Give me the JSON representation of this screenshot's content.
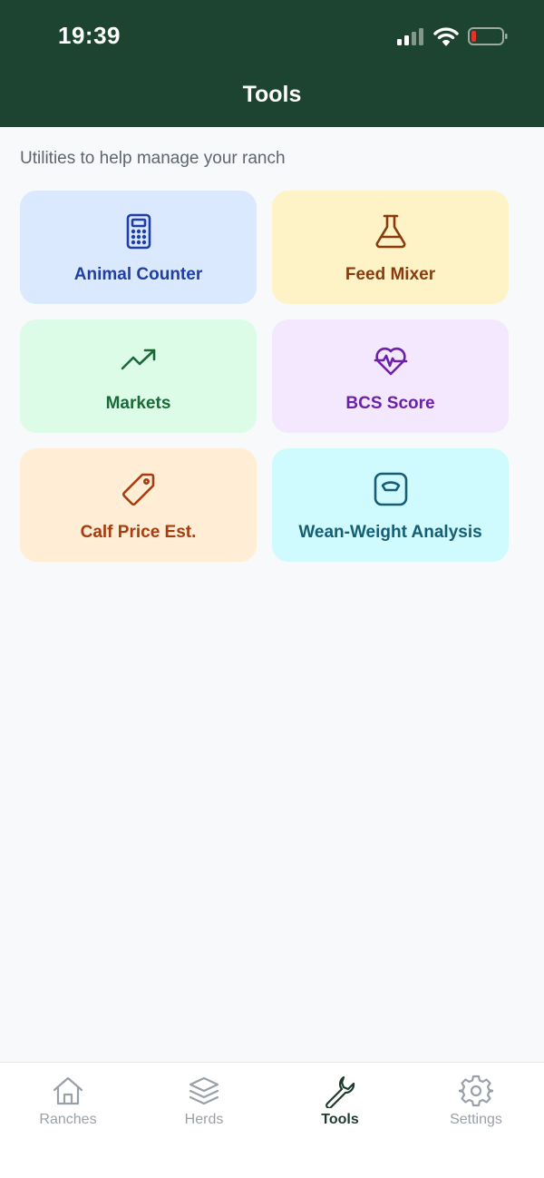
{
  "status_bar": {
    "time": "19:39"
  },
  "header": {
    "title": "Tools"
  },
  "subtitle": "Utilities to help manage your ranch",
  "tools": [
    {
      "label": "Animal Counter",
      "icon": "calculator-icon",
      "bg": "#dbe9fe",
      "color": "#1f3fa6"
    },
    {
      "label": "Feed Mixer",
      "icon": "flask-icon",
      "bg": "#fef3c7",
      "color": "#8a3b0d"
    },
    {
      "label": "Markets",
      "icon": "trending-up-icon",
      "bg": "#dcfce7",
      "color": "#1a6a37"
    },
    {
      "label": "BCS Score",
      "icon": "heart-pulse-icon",
      "bg": "#f3e8fe",
      "color": "#6b21a8"
    },
    {
      "label": "Calf Price Est.",
      "icon": "tag-icon",
      "bg": "#ffedd5",
      "color": "#a43d10"
    },
    {
      "label": "Wean-Weight Analysis",
      "icon": "scale-icon",
      "bg": "#cffafe",
      "color": "#155e73"
    }
  ],
  "tabbar": {
    "items": [
      {
        "label": "Ranches",
        "icon": "home-icon",
        "active": false
      },
      {
        "label": "Herds",
        "icon": "layers-icon",
        "active": false
      },
      {
        "label": "Tools",
        "icon": "wrench-icon",
        "active": true
      },
      {
        "label": "Settings",
        "icon": "gear-icon",
        "active": false
      }
    ]
  },
  "colors": {
    "header_bg": "#1d4430",
    "active_tab": "#1d3b2c",
    "inactive_tab": "#9aa0a8",
    "battery_low": "#e5322d"
  }
}
